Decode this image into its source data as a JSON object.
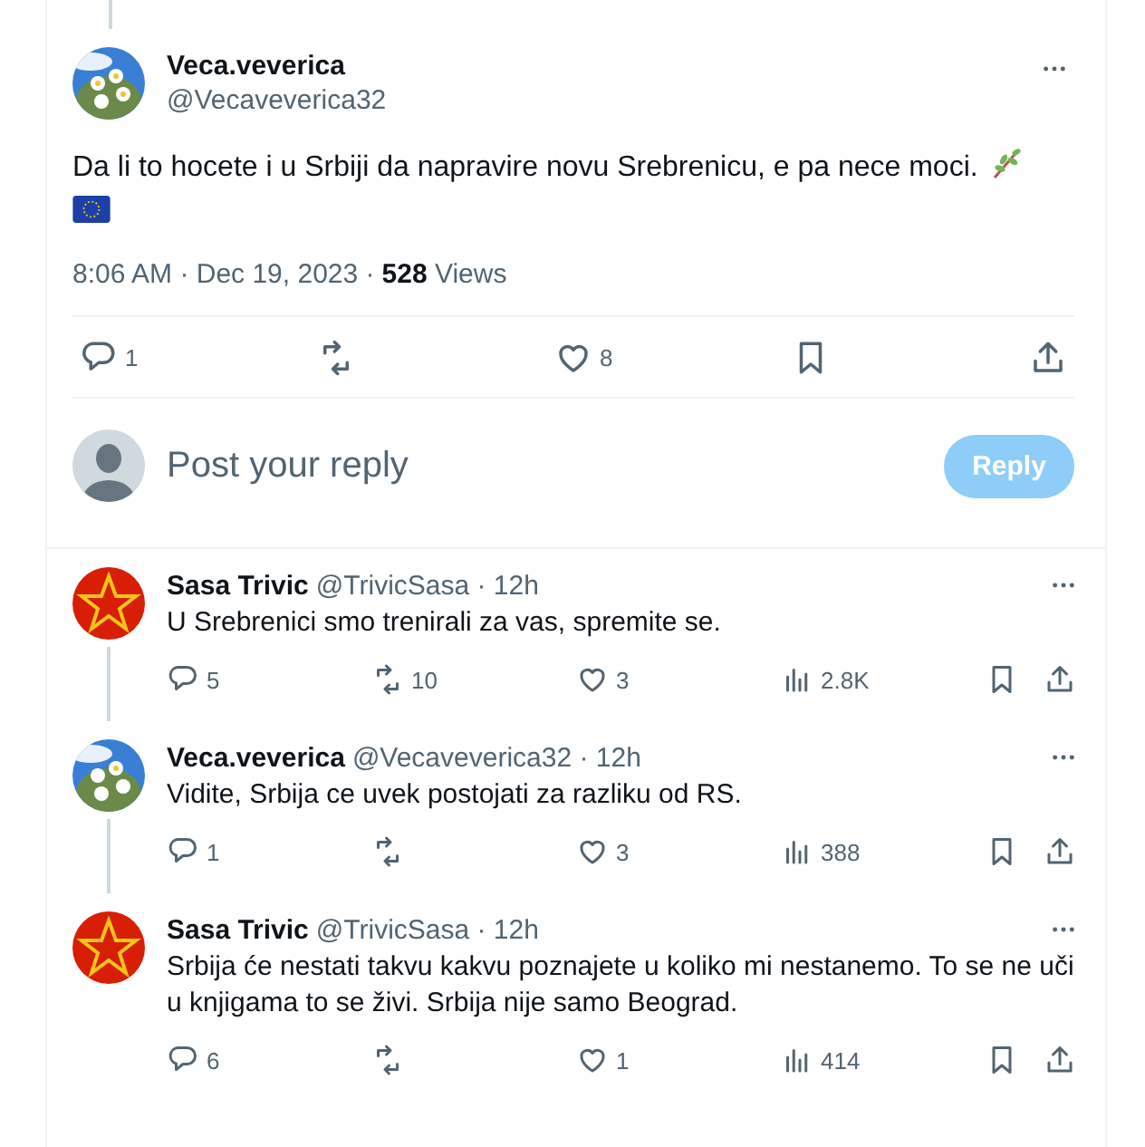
{
  "main_tweet": {
    "name": "Veca.veverica",
    "handle": "@Vecaveverica32",
    "text": "Da li to hocete i u Srbiji da napravire novu Srebrenicu, e pa nece moci.",
    "emojis": [
      {
        "kind": "leaf"
      },
      {
        "kind": "eu_flag"
      }
    ],
    "time": "8:06 AM · Dec 19, 2023 ·",
    "views": "528",
    "views_label": "Views",
    "actions": [
      {
        "kind": "reply",
        "count": "1"
      },
      {
        "kind": "repost"
      },
      {
        "kind": "like",
        "count": "8"
      },
      {
        "kind": "bookmark"
      },
      {
        "kind": "share"
      }
    ]
  },
  "reply_box": {
    "placeholder": "Post your reply",
    "button": "Reply",
    "disabled": true
  },
  "replies": [
    {
      "avatar": {
        "kind": "star"
      },
      "name": "Sasa Trivic",
      "handle": "@TrivicSasa · 12h",
      "text": "U Srebrenici smo trenirali za vas, spremite se.",
      "actions": [
        {
          "kind": "reply",
          "count": "5"
        },
        {
          "kind": "repost",
          "count": "10"
        },
        {
          "kind": "like",
          "count": "3"
        },
        {
          "kind": "views",
          "count": "2.8K"
        }
      ]
    },
    {
      "avatar": {
        "kind": "picture"
      },
      "name": "Veca.veverica",
      "handle": "@Vecaveverica32 · 12h",
      "text": "Vidite, Srbija ce uvek postojati za razliku od RS.",
      "actions": [
        {
          "kind": "reply",
          "count": "1"
        },
        {
          "kind": "repost"
        },
        {
          "kind": "like",
          "count": "3"
        },
        {
          "kind": "views",
          "count": "388"
        }
      ]
    },
    {
      "avatar": {
        "kind": "star"
      },
      "name": "Sasa Trivic",
      "handle": "@TrivicSasa · 12h",
      "text": "Srbija će nestati takvu kakvu poznajete u koliko mi nestanemo. To se ne uči u knjigama  to se živi. Srbija nije samo Beograd.",
      "actions": [
        {
          "kind": "reply",
          "count": "6"
        },
        {
          "kind": "repost"
        },
        {
          "kind": "like",
          "count": "1"
        },
        {
          "kind": "views",
          "count": "414"
        }
      ]
    }
  ]
}
